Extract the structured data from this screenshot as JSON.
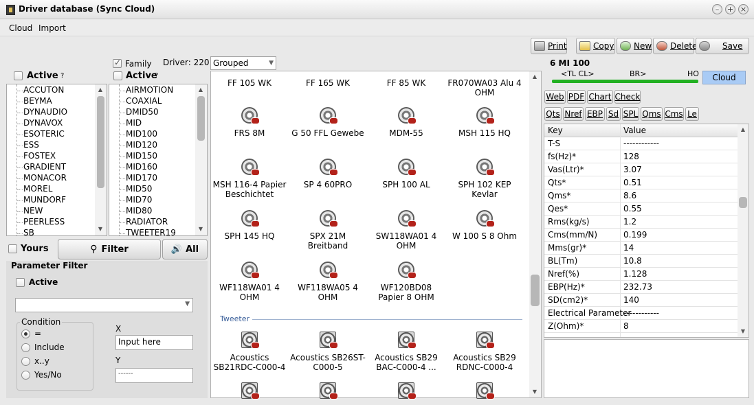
{
  "window": {
    "title": "Driver database (Sync Cloud)",
    "min": "–",
    "max": "+",
    "close": "×"
  },
  "menu": {
    "cloud": "Cloud",
    "import": "Import"
  },
  "toolbar": {
    "print": "Print",
    "copy": "Copy",
    "new": "New",
    "delete": "Delete",
    "save": "Save"
  },
  "left": {
    "family_label": "Family",
    "family_checked": true,
    "driver_count": "Driver: 220",
    "active_label_left": "Active",
    "active_label_right": "Active",
    "help": "?",
    "manufacturers": [
      "ACCUTON",
      "BEYMA",
      "DYNAUDIO",
      "DYNAVOX",
      "ESOTERIC",
      "ESS",
      "FOSTEX",
      "GRADIENT",
      "MONACOR",
      "MOREL",
      "MUNDORF",
      "NEW",
      "PEERLESS",
      "SB"
    ],
    "families": [
      "AIRMOTION",
      "COAXIAL",
      "DMID50",
      "MID",
      "MID100",
      "MID120",
      "MID150",
      "MID160",
      "MID170",
      "MID50",
      "MID70",
      "MID80",
      "RADIATOR",
      "TWEETER19"
    ],
    "yours_label": "Yours",
    "filter_label": "Filter",
    "all_label": "All",
    "param_filter_title": "Parameter Filter",
    "param_active_label": "Active",
    "condition_label": "Condition",
    "conditions": [
      "=",
      "Include",
      "x..y",
      "Yes/No"
    ],
    "selected_condition": 0,
    "x_label": "X",
    "x_value": "Input here",
    "y_label": "Y",
    "y_value": "------"
  },
  "middle": {
    "grouping": "Grouped",
    "woofer_rows": [
      [
        "FF 105 WK",
        "FF 165 WK",
        "FF 85 WK",
        "FR070WA03 Alu 4 OHM"
      ],
      [
        "FRS 8M",
        "G 50 FFL Gewebe",
        "MDM-55",
        "MSH 115 HQ"
      ],
      [
        "MSH 116-4 Papier Beschichtet",
        "SP 4 60PRO",
        "SPH 100 AL",
        "SPH 102 KEP Kevlar"
      ],
      [
        "SPH 145 HQ",
        "SPX 21M Breitband",
        "SW118WA01 4 OHM",
        "W 100 S 8 Ohm"
      ],
      [
        "WF118WA01 4 OHM",
        "WF118WA05 4 OHM",
        "WF120BD08 Papier 8 OHM"
      ]
    ],
    "group_tweeter": "Tweeter",
    "tweeter_row": [
      "Acoustics SB21RDC-C000-4",
      "Acoustics SB26ST-C000-5",
      "Acoustics SB29 BAC-C000-4 ...",
      "Acoustics SB29 RDNC-C000-4"
    ]
  },
  "right": {
    "driver_name": "6 MI 100",
    "band_tl_cl": "<TL CL>",
    "band_br": "BR>",
    "band_ho": "HO",
    "cloud_label": "Cloud",
    "band_color": "#22b022",
    "cloud_color": "#a9cbf5",
    "tabs1": [
      "Web",
      "PDF",
      "Chart",
      "Check"
    ],
    "tabs2": [
      "Qts",
      "Nref",
      "EBP",
      "Sd",
      "SPL",
      "Qms",
      "Cms",
      "Le"
    ],
    "col_key": "Key",
    "col_value": "Value",
    "rows": [
      {
        "k": "T-S",
        "v": "------------"
      },
      {
        "k": "fs(Hz)*",
        "v": "128"
      },
      {
        "k": "Vas(Ltr)*",
        "v": "3.07"
      },
      {
        "k": "Qts*",
        "v": "0.51"
      },
      {
        "k": "Qms*",
        "v": "8.6"
      },
      {
        "k": "Qes*",
        "v": "0.55"
      },
      {
        "k": "Rms(kg/s)",
        "v": "1.2"
      },
      {
        "k": "Cms(mm/N)",
        "v": "0.199"
      },
      {
        "k": "Mms(gr)*",
        "v": "14"
      },
      {
        "k": "BL(Tm)",
        "v": "10.8"
      },
      {
        "k": "Nref(%)",
        "v": "1.128"
      },
      {
        "k": "EBP(Hz)*",
        "v": "232.73"
      },
      {
        "k": "SD(cm2)*",
        "v": "140"
      },
      {
        "k": "Electrical Parameter",
        "v": "------------"
      },
      {
        "k": "Z(Ohm)*",
        "v": "8"
      }
    ]
  }
}
